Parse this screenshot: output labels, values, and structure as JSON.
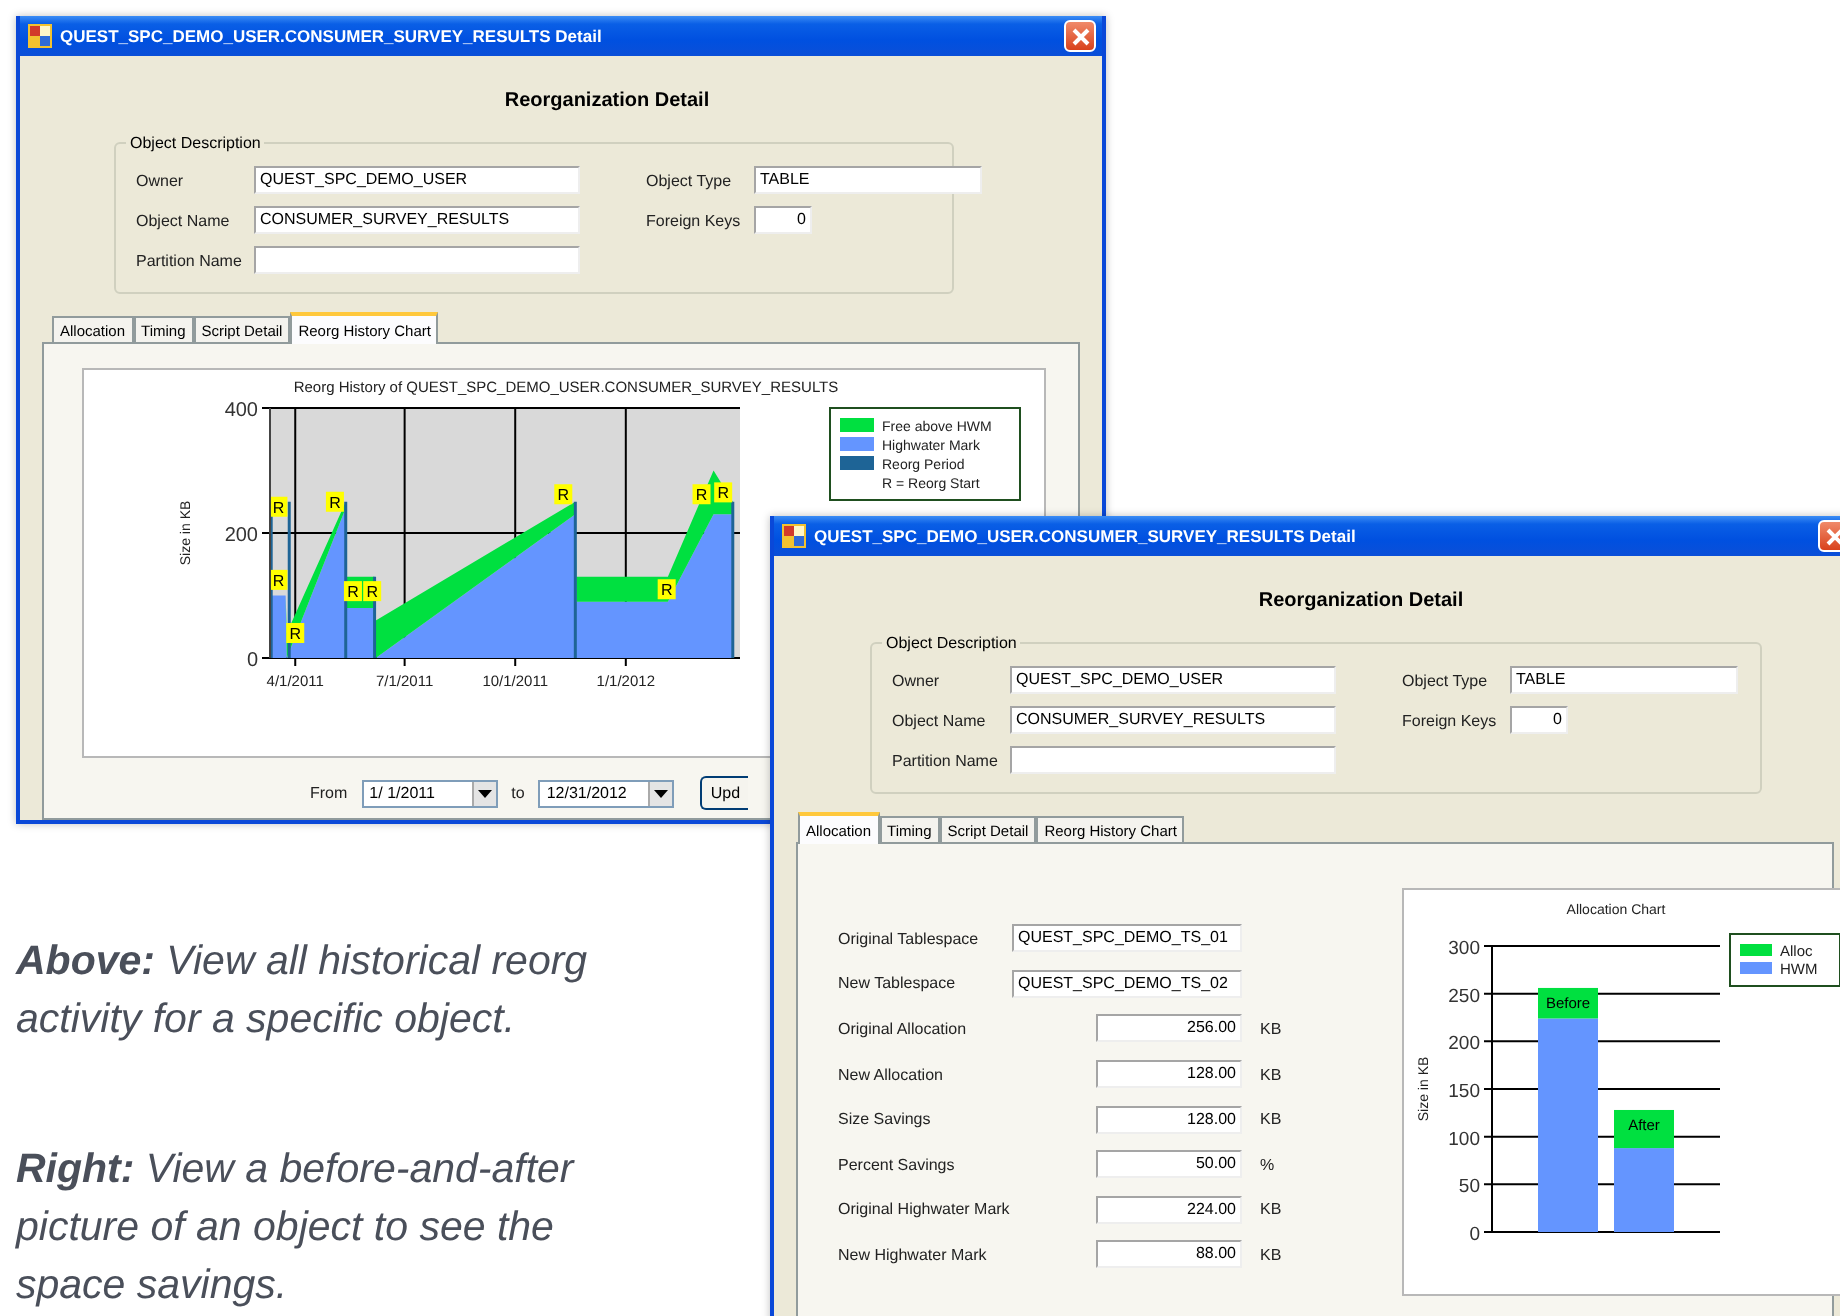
{
  "windows": [
    {
      "title": "QUEST_SPC_DEMO_USER.CONSUMER_SURVEY_RESULTS Detail",
      "heading": "Reorganization Detail",
      "object_description": {
        "legend": "Object Description",
        "left_fields": [
          {
            "label": "Owner",
            "value": "QUEST_SPC_DEMO_USER"
          },
          {
            "label": "Object Name",
            "value": "CONSUMER_SURVEY_RESULTS"
          },
          {
            "label": "Partition Name"
          }
        ],
        "right_fields": [
          {
            "label": "Object Type",
            "value": "TABLE",
            "kind": "text"
          },
          {
            "label": "Foreign Keys",
            "value": "0",
            "kind": "number"
          }
        ]
      },
      "tabs": [
        {
          "label": "Allocation",
          "selected": false
        },
        {
          "label": "Timing",
          "selected": false
        },
        {
          "label": "Script Detail",
          "selected": false
        },
        {
          "label": "Reorg History Chart",
          "selected": true
        }
      ],
      "content": {
        "kind": "history",
        "legend_extra": [
          {
            "label": "Reorg Period",
            "color": "#1e6496"
          }
        ],
        "legend_note": "R = Reorg Start",
        "markers": [
          "R",
          "R",
          "R",
          "R",
          "R",
          "R",
          "R",
          "R",
          "R",
          "R"
        ],
        "chart_data": {
          "type": "area",
          "title": "Reorg History of QUEST_SPC_DEMO_USER.CONSUMER_SURVEY_RESULTS",
          "ylabel": "Size in KB",
          "stacked": true,
          "grid": true,
          "legend": "right",
          "x": [
            "2011-03-12",
            "2011-03-24",
            "2011-03-25",
            "2011-05-13",
            "2011-05-14",
            "2011-06-06",
            "2011-06-07",
            "2011-11-20",
            "2011-11-21",
            "2012-02-05",
            "2012-03-14",
            "2012-03-30"
          ],
          "series": [
            {
              "name": "Free above HWM",
              "color": "#00e040",
              "values": [
                0,
                0,
                40,
                10,
                50,
                50,
                60,
                20,
                40,
                40,
                70,
                20
              ]
            },
            {
              "name": "Highwater Mark",
              "color": "#6495ff",
              "values": [
                100,
                100,
                0,
                240,
                80,
                80,
                0,
                230,
                90,
                90,
                230,
                230
              ]
            }
          ],
          "xlim": [
            "2011-03-11",
            "2012-04-05"
          ],
          "ylim": [
            0,
            400
          ],
          "yticks": [
            0,
            200,
            400
          ],
          "xticks": [
            {
              "value": "2011-04-01",
              "label": "4/1/2011"
            },
            {
              "value": "2011-07-01",
              "label": "7/1/2011"
            },
            {
              "value": "2011-10-01",
              "label": "10/1/2011"
            },
            {
              "value": "2012-01-01",
              "label": "1/1/2012"
            }
          ]
        },
        "date_range": {
          "from_label": "From",
          "from": "1/ 1/2011",
          "to_label": "to",
          "to": "12/31/2012",
          "button": "Upd"
        }
      }
    },
    {
      "title": "QUEST_SPC_DEMO_USER.CONSUMER_SURVEY_RESULTS Detail",
      "heading": "Reorganization Detail",
      "object_description": {
        "legend": "Object Description",
        "left_fields": [
          {
            "label": "Owner",
            "value": "QUEST_SPC_DEMO_USER"
          },
          {
            "label": "Object Name",
            "value": "CONSUMER_SURVEY_RESULTS"
          },
          {
            "label": "Partition Name"
          }
        ],
        "right_fields": [
          {
            "label": "Object Type",
            "value": "TABLE",
            "kind": "text"
          },
          {
            "label": "Foreign Keys",
            "value": "0",
            "kind": "number"
          }
        ]
      },
      "tabs": [
        {
          "label": "Allocation",
          "selected": true
        },
        {
          "label": "Timing",
          "selected": false
        },
        {
          "label": "Script Detail",
          "selected": false
        },
        {
          "label": "Reorg History Chart",
          "selected": false
        }
      ],
      "content": {
        "kind": "allocation",
        "fields": [
          {
            "label": "Original Tablespace",
            "value": "QUEST_SPC_DEMO_TS_01",
            "kind": "text"
          },
          {
            "label": "New Tablespace",
            "value": "QUEST_SPC_DEMO_TS_02",
            "kind": "text"
          },
          {
            "label": "Original Allocation",
            "value": "256.00",
            "unit": "KB",
            "kind": "number"
          },
          {
            "label": "New Allocation",
            "value": "128.00",
            "unit": "KB",
            "kind": "number"
          },
          {
            "label": "Size Savings",
            "value": "128.00",
            "unit": "KB",
            "kind": "number"
          },
          {
            "label": "Percent Savings",
            "value": "50.00",
            "unit": "%",
            "kind": "number"
          },
          {
            "label": "Original Highwater Mark",
            "value": "224.00",
            "unit": "KB",
            "kind": "number"
          },
          {
            "label": "New Highwater Mark",
            "value": "88.00",
            "unit": "KB",
            "kind": "number"
          }
        ],
        "chart_data": {
          "type": "bar",
          "title": "Allocation Chart",
          "ylabel": "Size in KB",
          "stacked": true,
          "grid": true,
          "legend": "right",
          "categories": [
            "Before",
            "After"
          ],
          "series": [
            {
              "name": "Alloc",
              "color": "#00e040",
              "values": [
                32,
                40
              ]
            },
            {
              "name": "HWM",
              "color": "#6495ff",
              "values": [
                224,
                88
              ]
            }
          ],
          "ylim": [
            0,
            300
          ],
          "yticks": [
            0,
            50,
            100,
            150,
            200,
            250,
            300
          ]
        }
      }
    }
  ],
  "captions": [
    "**Above:** View all historical reorg activity for a specific object.",
    "**Right:** View a before-and-after picture of an object to see the space savings."
  ]
}
